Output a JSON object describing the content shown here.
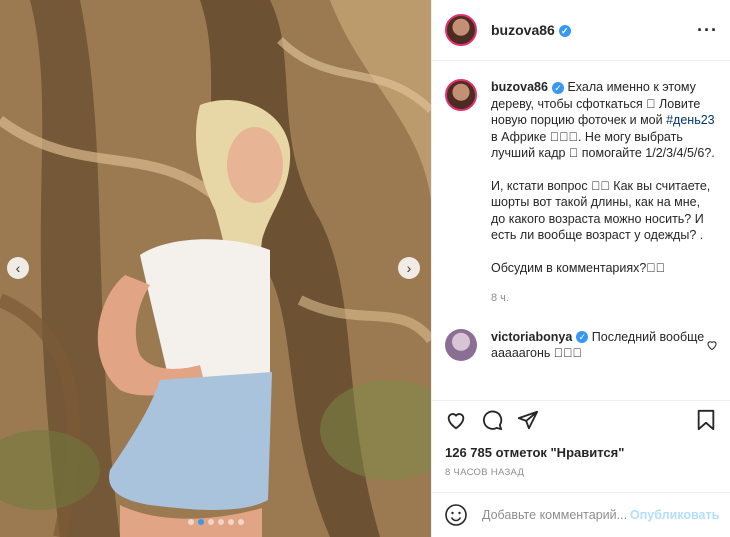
{
  "post": {
    "username": "buzova86",
    "verified_icon": "verified-badge-icon",
    "more_icon": "more-options-icon"
  },
  "carousel": {
    "prev_icon": "chevron-left-icon",
    "next_icon": "chevron-right-icon",
    "slide_count": 6,
    "active_slide": 2,
    "prev_glyph": "‹",
    "next_glyph": "›"
  },
  "caption": {
    "username": "buzova86",
    "line1": "Ехала именно к этому дереву, чтобы сфоткаться ⃞ Ловите новую порцию фоточек и мой",
    "hashtag": "#день23",
    "line2": " в Африке ⃞⃞⃞. Не могу выбрать лучший кадр ⃞ помогайте 1/2/3/4/5/6?.",
    "para2": "И, кстати вопрос ⃞⃞ Как вы считаете, шорты вот такой длины, как на мне, до какого возраста можно носить? И есть ли вообще возраст у одежды? .",
    "para3": "Обсудим в комментариях?⃞⃞",
    "time": "8 ч."
  },
  "comment": {
    "username": "victoriabonya",
    "text": " Последний вообще ааааагонь ⃞⃞⃞",
    "like_icon": "heart-outline-icon"
  },
  "actions": {
    "like_icon": "heart-icon",
    "comment_icon": "comment-icon",
    "share_icon": "share-icon",
    "save_icon": "bookmark-icon"
  },
  "likes": "126 785 отметок \"Нравится\"",
  "posted_ago": "8 ЧАСОВ НАЗАД",
  "add_comment": {
    "emoji_icon": "emoji-icon",
    "placeholder": "Добавьте комментарий...",
    "publish_label": "Опубликовать"
  },
  "colors": {
    "accent": "#3897f0",
    "publish_disabled": "#b2dffc",
    "border": "#efefef",
    "muted": "#8e8e8e"
  }
}
